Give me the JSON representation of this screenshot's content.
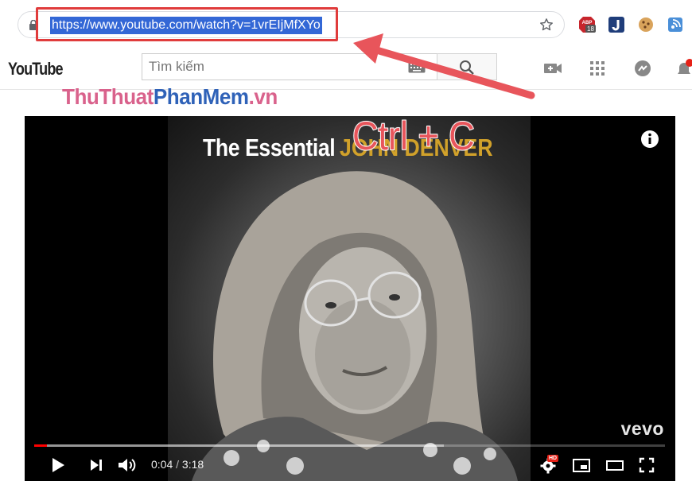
{
  "browser": {
    "url": "https://www.youtube.com/watch?v=1vrEIjMfXYo",
    "extensions": [
      {
        "name": "adblock-icon",
        "badge": "18"
      },
      {
        "name": "j-extension-icon"
      },
      {
        "name": "cookie-icon"
      },
      {
        "name": "share-icon"
      }
    ]
  },
  "youtube": {
    "logo_text": "YouTube",
    "search_placeholder": "Tìm kiếm",
    "header_icons": [
      "create-video-icon",
      "apps-grid-icon",
      "chat-icon",
      "notifications-bell-icon"
    ]
  },
  "watermark": {
    "part1": "ThuThuat",
    "part2": "PhanMem",
    "part3": ".vn"
  },
  "annotation": {
    "shortcut": "Ctrl + C"
  },
  "video": {
    "cover_title": "The Essential",
    "cover_artist": "JOHN DENVER",
    "brand": "vevo",
    "current_time": "0:04",
    "separator": "/",
    "duration": "3:18",
    "progress_fraction": 0.02,
    "buffer_fraction": 0.65,
    "hd_badge": "HD"
  },
  "colors": {
    "url_selection": "#3367d6",
    "highlight_box": "#e03c3c",
    "annotation_red": "#e8555b",
    "progress_red": "#ff0000",
    "watermark_pink": "#d9628c",
    "watermark_blue": "#2f62b8"
  }
}
